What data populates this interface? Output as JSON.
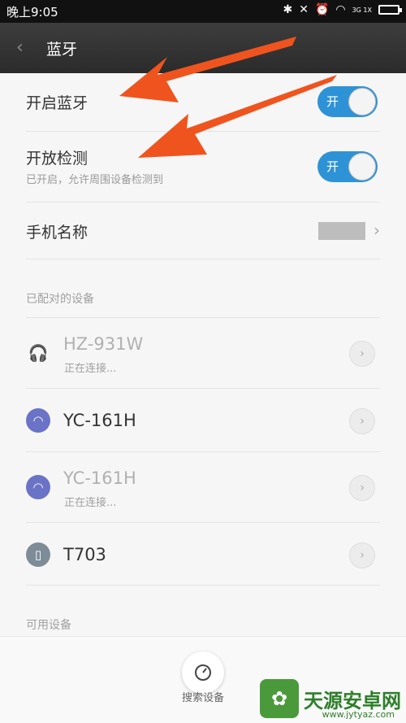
{
  "status_bar": {
    "time": "晚上9:05",
    "network": "3G 1X"
  },
  "title_bar": {
    "title": "蓝牙"
  },
  "settings": {
    "bluetooth_label": "开启蓝牙",
    "bluetooth_toggle": "开",
    "discoverable_label": "开放检测",
    "discoverable_sub": "已开启，允许周围设备检测到",
    "discoverable_toggle": "开",
    "device_name_label": "手机名称"
  },
  "paired_header": "已配对的设备",
  "devices": [
    {
      "name": "HZ-931W",
      "status": "正在连接...",
      "icon": "headset-icon"
    },
    {
      "name": "YC-161H",
      "status": "",
      "icon": "headphones-icon"
    },
    {
      "name": "YC-161H",
      "status": "正在连接...",
      "icon": "headphones-icon"
    },
    {
      "name": "T703",
      "status": "",
      "icon": "phone-icon"
    }
  ],
  "available_header": "可用设备",
  "bottom": {
    "search_label": "搜索设备"
  },
  "watermark": {
    "text": "天源安卓网",
    "url": "www.jytyaz.com"
  },
  "colors": {
    "toggle_on": "#2e93d6",
    "title_bar": "#333333",
    "device_icon_purple": "#6b73c6",
    "annotation_arrow": "#f0541e"
  }
}
